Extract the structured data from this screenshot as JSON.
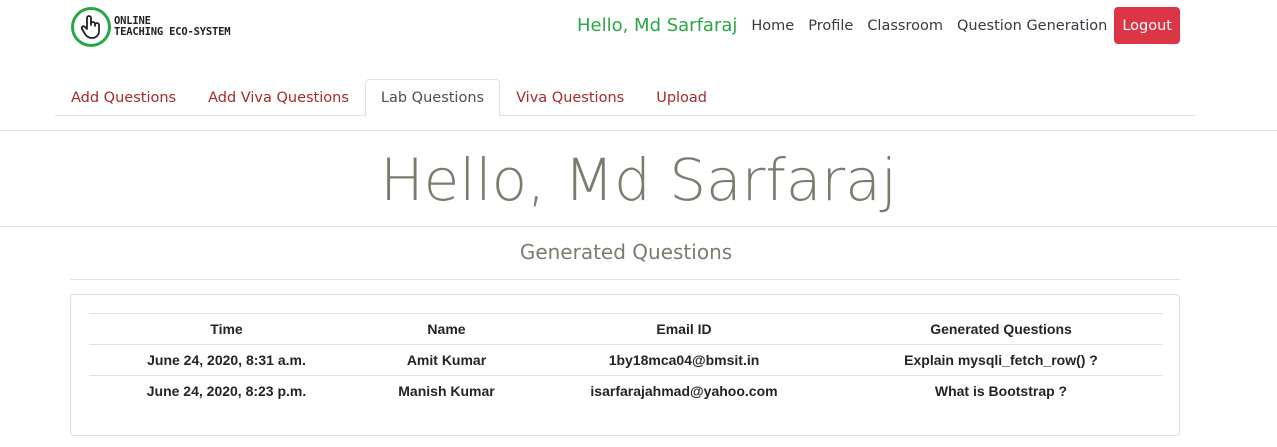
{
  "brand": {
    "line1": "ONLINE",
    "line2": "TEACHING ECO-SYSTEM"
  },
  "nav": {
    "greeting": "Hello, Md Sarfaraj",
    "links": [
      "Home",
      "Profile",
      "Classroom",
      "Question Generation"
    ],
    "logout": "Logout"
  },
  "tabs": [
    "Add Questions",
    "Add Viva Questions",
    "Lab Questions",
    "Viva Questions",
    "Upload"
  ],
  "active_tab": "Lab Questions",
  "main": {
    "title": "Hello, Md Sarfaraj",
    "subtitle": "Generated Questions"
  },
  "table": {
    "headers": [
      "Time",
      "Name",
      "Email ID",
      "Generated Questions"
    ],
    "rows": [
      [
        "June 24, 2020, 8:31 a.m.",
        "Amit Kumar",
        "1by18mca04@bmsit.in",
        "Explain mysqli_fetch_row() ?"
      ],
      [
        "June 24, 2020, 8:23 p.m.",
        "Manish Kumar",
        "isarfarajahmad@yahoo.com",
        "What is Bootstrap ?"
      ]
    ]
  },
  "colors": {
    "accent_green": "#28a745",
    "logout_red": "#dc3545",
    "tab_text": "#a52a2a",
    "heading_gray": "#7d7b6e"
  }
}
